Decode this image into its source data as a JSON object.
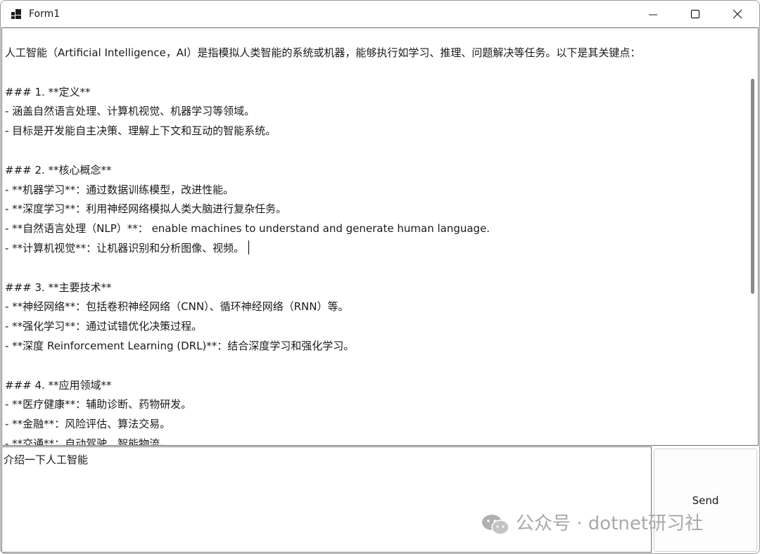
{
  "window": {
    "title": "Form1"
  },
  "output": {
    "lines": [
      "人工智能（Artificial Intelligence，AI）是指模拟人类智能的系统或机器，能够执行如学习、推理、问题解决等任务。以下是其关键点：",
      "",
      "### 1. **定义**",
      "- 涵盖自然语言处理、计算机视觉、机器学习等领域。",
      "- 目标是开发能自主决策、理解上下文和互动的智能系统。",
      "",
      "### 2. **核心概念**",
      "- **机器学习**：通过数据训练模型，改进性能。",
      "- **深度学习**：利用神经网络模拟人类大脑进行复杂任务。",
      "- **自然语言处理（NLP）**： enable machines to understand and generate human language.",
      "- **计算机视觉**：让机器识别和分析图像、视频。",
      "",
      "### 3. **主要技术**",
      "- **神经网络**：包括卷积神经网络（CNN）、循环神经网络（RNN）等。",
      "- **强化学习**：通过试错优化决策过程。",
      "- **深度 Reinforcement Learning (DRL)**：结合深度学习和强化学习。",
      "",
      "### 4. **应用领域**",
      "- **医疗健康**：辅助诊断、药物研发。",
      "- **金融**：风险评估、算法交易。",
      "- **交通**：自动驾驶、智能物流。"
    ]
  },
  "input": {
    "value": "介绍一下人工智能"
  },
  "send_button": {
    "label": "Send"
  },
  "watermark": {
    "text": "公众号 · dotnet研习社"
  }
}
